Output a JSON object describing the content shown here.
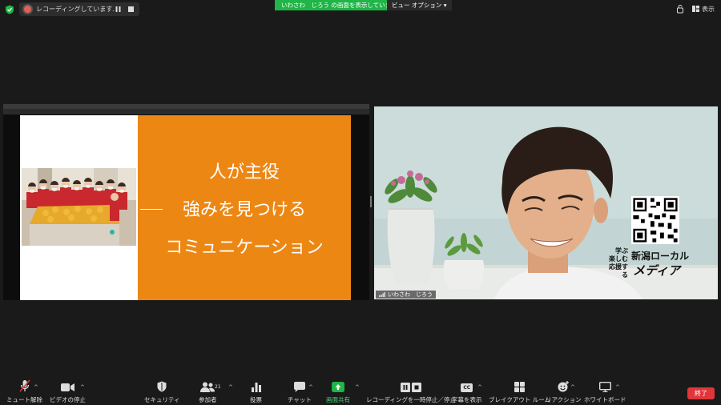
{
  "top_bar": {
    "recording_status": "レコーディングしています...",
    "share_banner": "いわさわ　じろう の画面を表示しています",
    "view_options": "ビュー オプション",
    "view_label": "表示"
  },
  "shared_screen": {
    "slide_lines": [
      "人が主役",
      "強みを見つける",
      "コミュニケーション"
    ],
    "colors": {
      "accent": "#ed8714"
    }
  },
  "camera": {
    "participant_name": "いわさわ　じろう",
    "brand_small_lines": [
      "学ぶ",
      "楽しむ",
      "応援する"
    ],
    "brand_name": "新潟ローカル",
    "brand_media": "メディア"
  },
  "toolbar": {
    "mute": "ミュート解除",
    "video": "ビデオの停止",
    "security": "セキュリティ",
    "participants": "参加者",
    "participants_count": "21",
    "polls": "投票",
    "chat": "チャット",
    "share": "画面共有",
    "record": "レコーディングを一時停止／停止",
    "captions": "字幕を表示",
    "cc_icon_text": "CC",
    "breakout": "ブレイクアウト ルーム",
    "reactions": "リアクション",
    "whiteboard": "ホワイトボード",
    "end": "終了"
  },
  "colors": {
    "share_green": "#1fb547",
    "end_red": "#e0353a"
  }
}
